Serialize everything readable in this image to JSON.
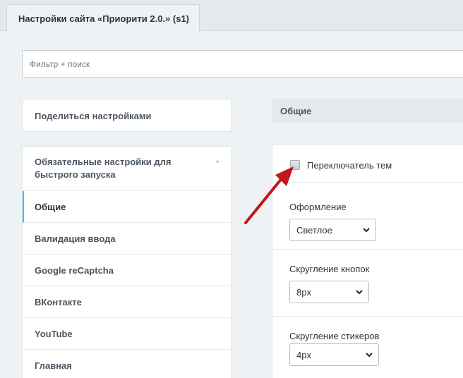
{
  "tab": {
    "title": "Настройки сайта «Приорити 2.0.» (s1)"
  },
  "filter": {
    "placeholder": "Фильтр + поиск"
  },
  "share_label": "Поделиться настройками",
  "menu": {
    "items": [
      {
        "label": "Обязательные настройки для быстрого запуска",
        "marker": "*"
      },
      {
        "label": "Общие"
      },
      {
        "label": "Валидация ввода"
      },
      {
        "label": "Google reCaptcha"
      },
      {
        "label": "ВКонтакте"
      },
      {
        "label": "YouTube"
      },
      {
        "label": "Главная"
      }
    ]
  },
  "section": {
    "title": "Общие"
  },
  "settings": {
    "theme_switch": {
      "label": "Переключатель тем",
      "checked": false
    },
    "appearance": {
      "label": "Оформление",
      "value": "Светлое"
    },
    "button_radius": {
      "label": "Скругление кнопок",
      "value": "8px"
    },
    "sticker_radius": {
      "label": "Скругление стикеров",
      "value": "4px"
    }
  },
  "colors": {
    "accent": "#2fc6f6",
    "annotation_arrow": "#c0161c"
  }
}
